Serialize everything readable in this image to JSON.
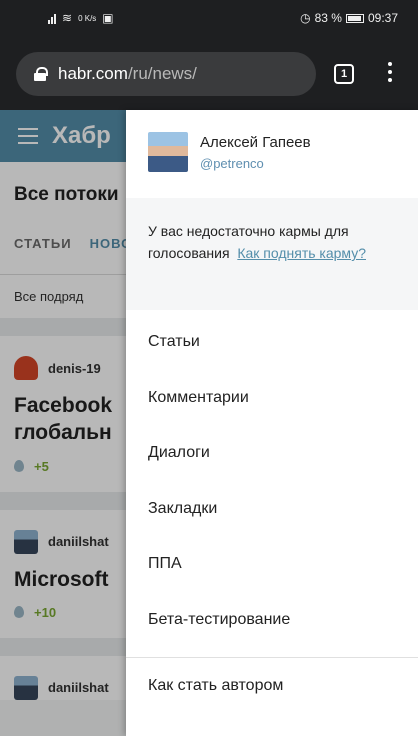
{
  "status_bar": {
    "network_speed": "0 K/s",
    "battery": "83 %",
    "time": "09:37"
  },
  "browser": {
    "url_host": "habr.com",
    "url_path": "/ru/news/",
    "tab_count": "1"
  },
  "page": {
    "site_title": "Хабр",
    "section_title": "Все потоки",
    "tabs": [
      "СТАТЬИ",
      "НОВОСТИ"
    ],
    "filter": "Все подряд",
    "posts": [
      {
        "author": "denis-19",
        "title": "Facebook ... глобальн...",
        "title_line1": "Facebook",
        "title_line2": "глобальн",
        "score": "+5"
      },
      {
        "author": "daniilshat",
        "title_line1": "Microsoft",
        "score": "+10"
      },
      {
        "author": "daniilshat"
      }
    ]
  },
  "drawer": {
    "user_name": "Алексей Гапеев",
    "user_handle": "@petrenco",
    "karma_text": "У вас недостаточно кармы для голосования",
    "karma_link": "Как поднять карму?",
    "menu": [
      "Статьи",
      "Комментарии",
      "Диалоги",
      "Закладки",
      "ППА",
      "Бета-тестирование"
    ],
    "author_link": "Как стать автором"
  },
  "colors": {
    "brand": "#548eaa",
    "chrome_bar": "#1e1f21",
    "score_positive": "#7ba833"
  },
  "icons": [
    "signal-icon",
    "wifi-icon",
    "nfc-icon",
    "alarm-icon",
    "battery-icon",
    "lock-icon",
    "tab-switcher-icon",
    "overflow-menu-icon",
    "hamburger-menu-icon"
  ]
}
